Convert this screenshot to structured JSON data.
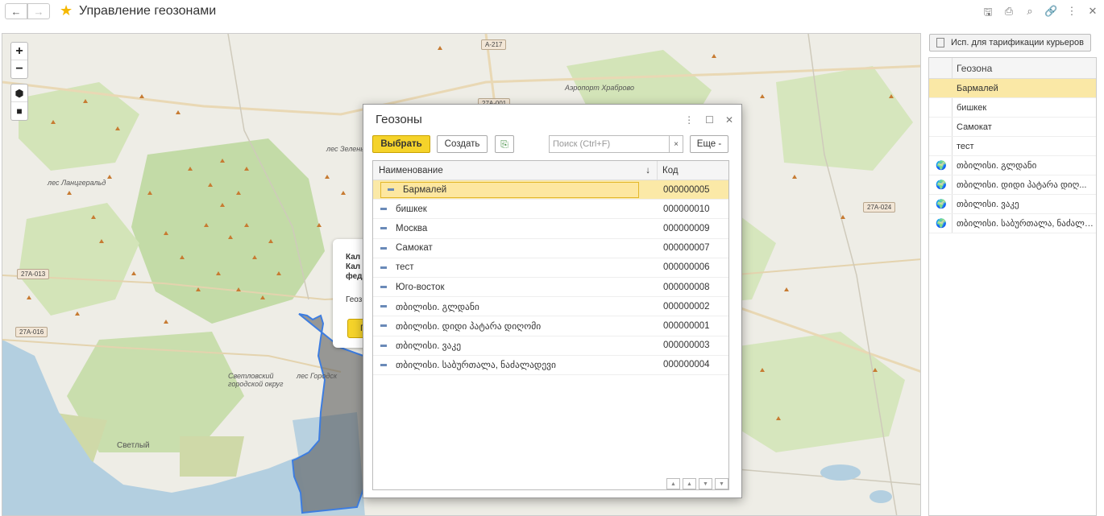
{
  "header": {
    "title": "Управление геозонами",
    "back_icon": "arrow-left-icon",
    "forward_icon": "arrow-right-icon"
  },
  "map": {
    "zoom_in": "+",
    "zoom_out": "−",
    "labels": {
      "airport": "Аэропорт Храброво",
      "forest1": "лес Ланцгеральд",
      "forest2": "лес Зелены",
      "svetly_district": "Светловский городской округ",
      "svetly": "Светлый",
      "city_edge": "лес Городск"
    },
    "roads": [
      "A-217",
      "27A-001",
      "27A-013",
      "27A-016",
      "27A-024"
    ],
    "popup": {
      "line1": "Кал",
      "line2": "Кал",
      "line3": "фед",
      "line4": "Геоз",
      "button": "П"
    }
  },
  "right_panel": {
    "toggle_label": "Исп. для тарификации курьеров",
    "column_header": "Геозона",
    "items": [
      {
        "label": "Бармалей",
        "icon": ""
      },
      {
        "label": "бишкек",
        "icon": ""
      },
      {
        "label": "Самокат",
        "icon": ""
      },
      {
        "label": "тест",
        "icon": ""
      },
      {
        "label": "თბილისი. გლდანი",
        "icon": "globe-icon"
      },
      {
        "label": "თბილისი. დიდი პატარა დიღ...",
        "icon": "globe-icon"
      },
      {
        "label": "თბილისი. ვაკე",
        "icon": "globe-icon"
      },
      {
        "label": "თბილისი. საბურთალა, ნაძალა...",
        "icon": "globe-icon"
      }
    ]
  },
  "dialog": {
    "title": "Геозоны",
    "select_button": "Выбрать",
    "create_button": "Создать",
    "search_placeholder": "Поиск (Ctrl+F)",
    "search_clear": "×",
    "more_button": "Еще -",
    "columns": {
      "name": "Наименование",
      "sort": "↓",
      "code": "Код"
    },
    "rows": [
      {
        "name": "Бармалей",
        "code": "000000005"
      },
      {
        "name": "бишкек",
        "code": "000000010"
      },
      {
        "name": "Москва",
        "code": "000000009"
      },
      {
        "name": "Самокат",
        "code": "000000007"
      },
      {
        "name": "тест",
        "code": "000000006"
      },
      {
        "name": "Юго-восток",
        "code": "000000008"
      },
      {
        "name": "თბილისი. გლდანი",
        "code": "000000002"
      },
      {
        "name": "თბილისი. დიდი პატარა დიღომი",
        "code": "000000001"
      },
      {
        "name": "თბილისი. ვაკე",
        "code": "000000003"
      },
      {
        "name": "თბილისი. საბურთალა, ნაძალადევი",
        "code": "000000004"
      }
    ]
  }
}
